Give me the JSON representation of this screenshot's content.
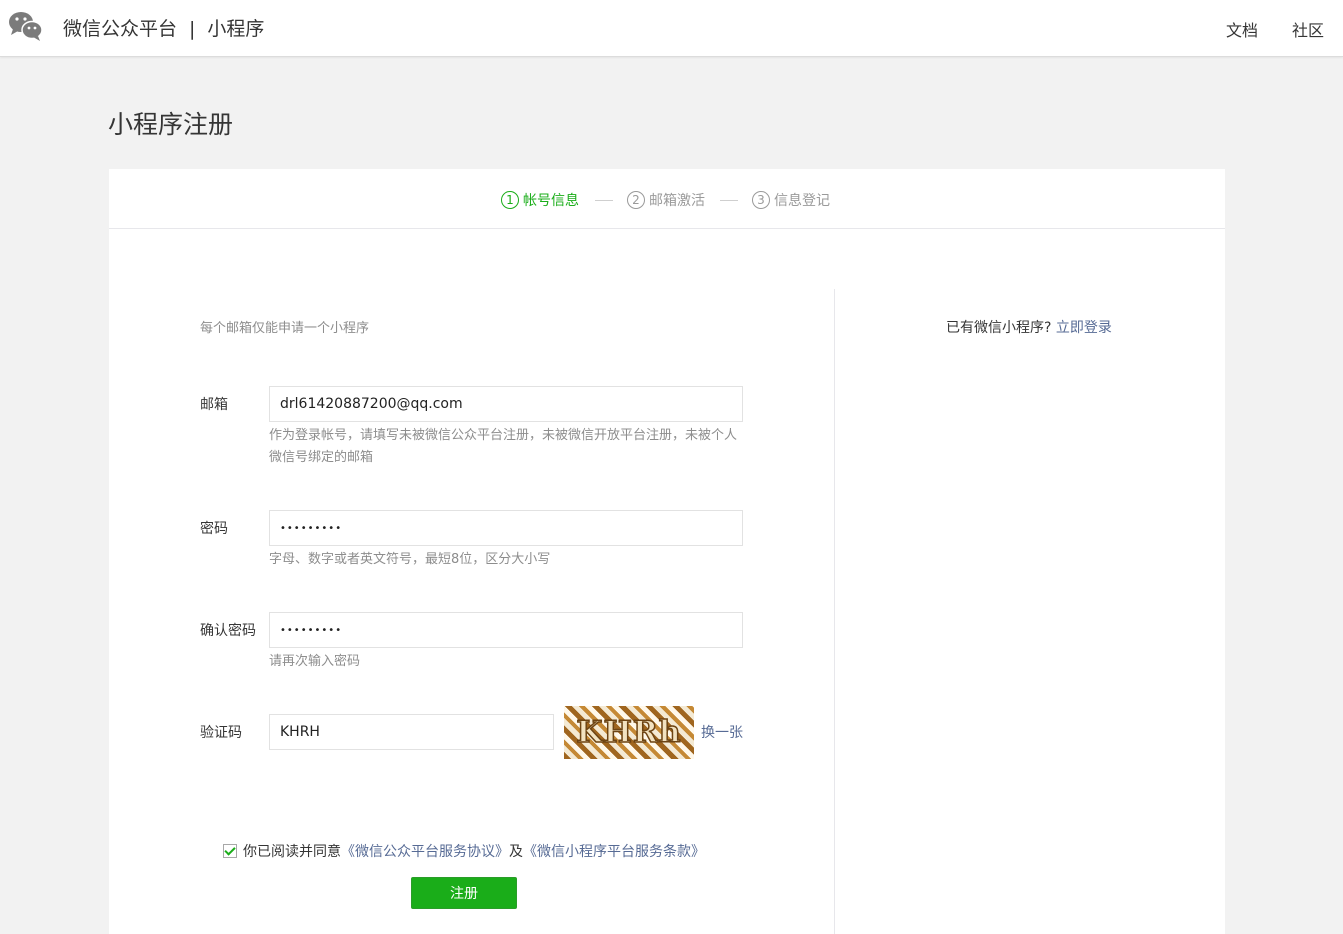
{
  "header": {
    "logo_icon": "wechat-logo-icon",
    "brand_name": "微信公众平台",
    "brand_separator": "|",
    "brand_product": "小程序",
    "nav": [
      "文档",
      "社区"
    ]
  },
  "page": {
    "title": "小程序注册"
  },
  "steps": [
    {
      "number": "1",
      "label": "帐号信息",
      "active": true
    },
    {
      "number": "2",
      "label": "邮箱激活",
      "active": false
    },
    {
      "number": "3",
      "label": "信息登记",
      "active": false
    }
  ],
  "form": {
    "tip": "每个邮箱仅能申请一个小程序",
    "email": {
      "label": "邮箱",
      "value": "drl61420887200@qq.com",
      "hint": "作为登录帐号，请填写未被微信公众平台注册，未被微信开放平台注册，未被个人微信号绑定的邮箱"
    },
    "password": {
      "label": "密码",
      "value": "•••••••••",
      "hint": "字母、数字或者英文符号，最短8位，区分大小写"
    },
    "confirm_password": {
      "label": "确认密码",
      "value": "•••••••••",
      "hint": "请再次输入密码"
    },
    "captcha": {
      "label": "验证码",
      "value": "KHRH",
      "image_text": "KHRh",
      "refresh": "换一张"
    },
    "agreement": {
      "checked": true,
      "prefix": "你已阅读并同意",
      "link1": "《微信公众平台服务协议》",
      "middle": "及",
      "link2": "《微信小程序平台服务条款》"
    },
    "submit": "注册"
  },
  "side": {
    "question": "已有微信小程序?",
    "login_link": "立即登录"
  },
  "colors": {
    "accent_green": "#1aad19",
    "link_blue": "#576b95",
    "hint_gray": "#8d8d8d",
    "background": "#f2f2f2"
  }
}
